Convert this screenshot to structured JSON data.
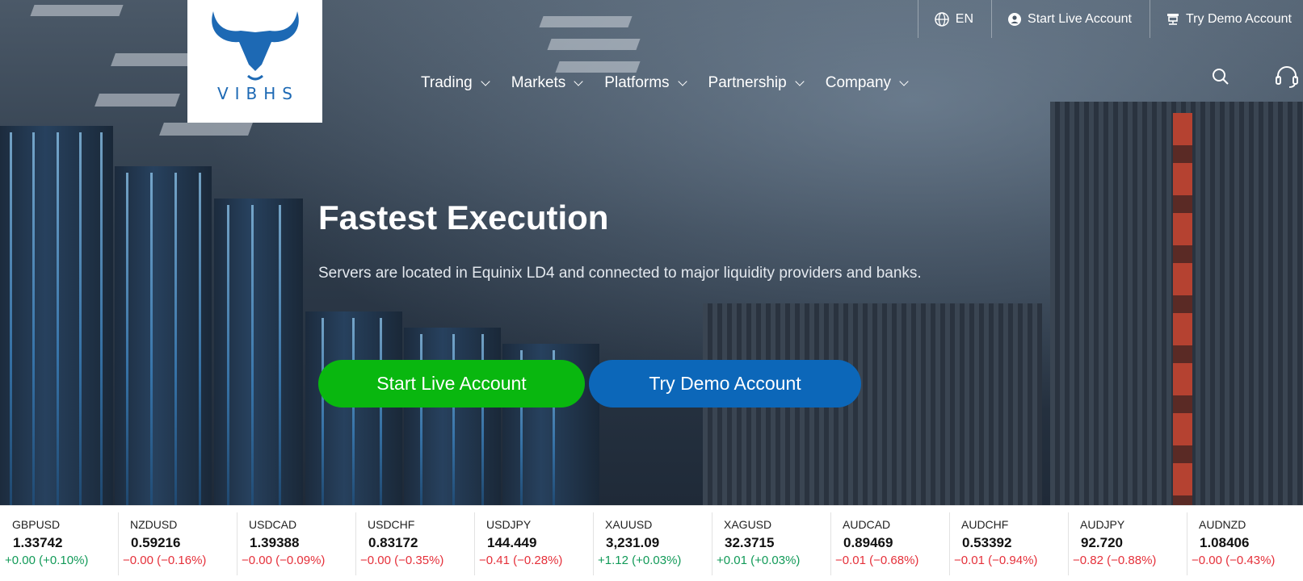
{
  "brand": {
    "logo_text": "VIBHS",
    "color": "#1d69b4"
  },
  "topbar": {
    "language": "EN",
    "live_account": "Start Live Account",
    "demo_account": "Try Demo Account"
  },
  "nav": {
    "items": [
      {
        "label": "Trading"
      },
      {
        "label": "Markets"
      },
      {
        "label": "Platforms"
      },
      {
        "label": "Partnership"
      },
      {
        "label": "Company"
      }
    ]
  },
  "hero": {
    "title": "Fastest Execution",
    "subtitle": "Servers are located in Equinix LD4 and connected to major liquidity providers and banks.",
    "live_button": "Start Live Account",
    "demo_button": "Try Demo Account",
    "live_color": "#09b70f",
    "demo_color": "#0c67b9"
  },
  "ticker": [
    {
      "symbol": "GBPUSD",
      "price": "1.33742",
      "change": "+0.00 (+0.10%)",
      "dir": "up"
    },
    {
      "symbol": "NZDUSD",
      "price": "0.59216",
      "change": "−0.00 (−0.16%)",
      "dir": "down"
    },
    {
      "symbol": "USDCAD",
      "price": "1.39388",
      "change": "−0.00 (−0.09%)",
      "dir": "down"
    },
    {
      "symbol": "USDCHF",
      "price": "0.83172",
      "change": "−0.00 (−0.35%)",
      "dir": "down"
    },
    {
      "symbol": "USDJPY",
      "price": "144.449",
      "change": "−0.41 (−0.28%)",
      "dir": "down"
    },
    {
      "symbol": "XAUUSD",
      "price": "3,231.09",
      "change": "+1.12 (+0.03%)",
      "dir": "up"
    },
    {
      "symbol": "XAGUSD",
      "price": "32.3715",
      "change": "+0.01 (+0.03%)",
      "dir": "up"
    },
    {
      "symbol": "AUDCAD",
      "price": "0.89469",
      "change": "−0.01 (−0.68%)",
      "dir": "down"
    },
    {
      "symbol": "AUDCHF",
      "price": "0.53392",
      "change": "−0.01 (−0.94%)",
      "dir": "down"
    },
    {
      "symbol": "AUDJPY",
      "price": "92.720",
      "change": "−0.82 (−0.88%)",
      "dir": "down"
    },
    {
      "symbol": "AUDNZD",
      "price": "1.08406",
      "change": "−0.00 (−0.43%)",
      "dir": "down"
    }
  ]
}
